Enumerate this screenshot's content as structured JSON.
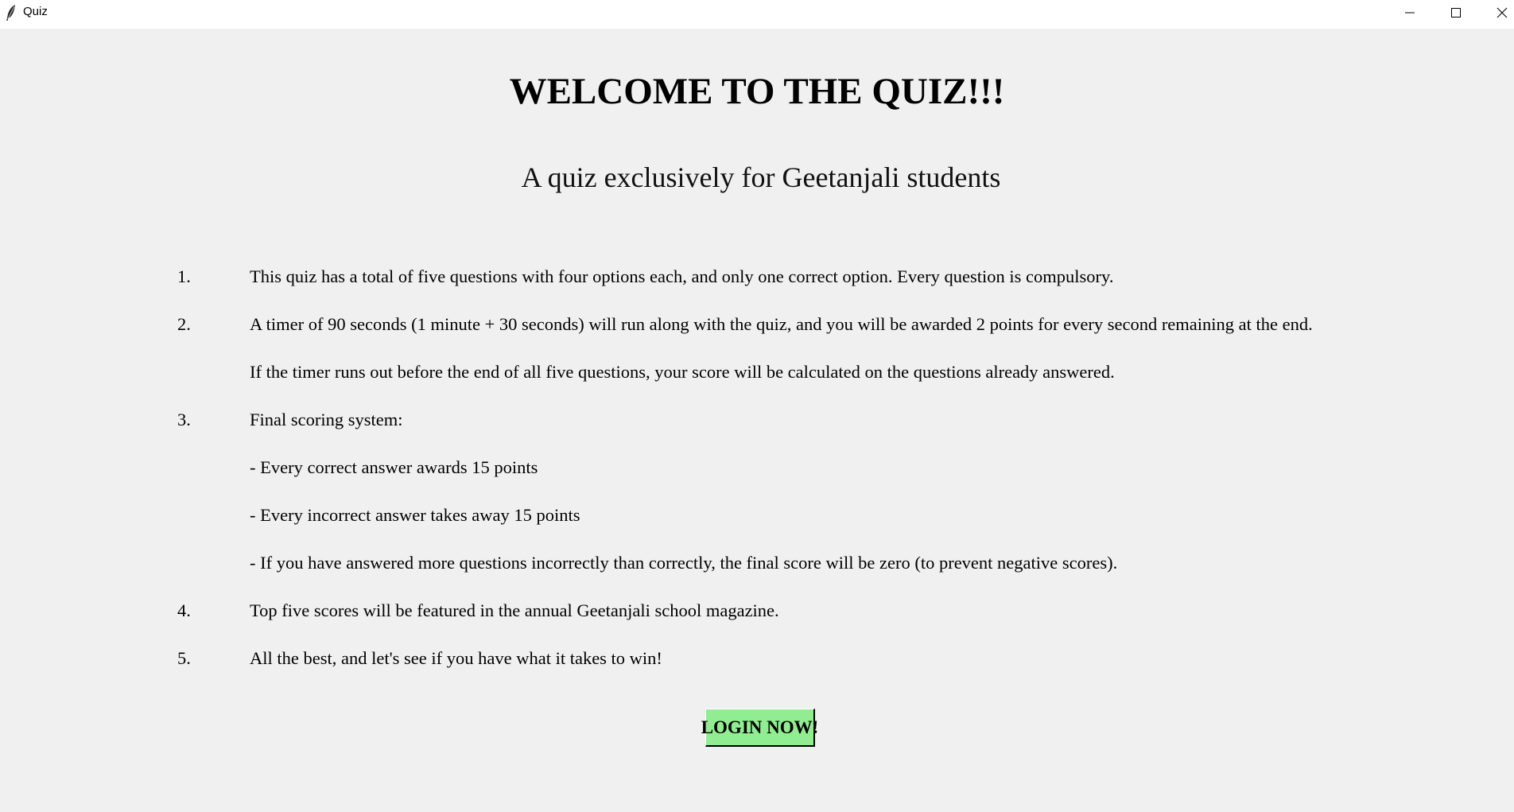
{
  "window": {
    "title": "Quiz",
    "icon": "feather-icon",
    "controls": [
      "minimize-icon",
      "maximize-icon",
      "close-icon"
    ]
  },
  "main": {
    "heading": "WELCOME TO THE QUIZ!!!",
    "subheading": "A quiz exclusively for Geetanjali students",
    "rules": [
      {
        "number": "1.",
        "text": "This quiz has a total of five questions with four options each, and only one correct option. Every question is compulsory."
      },
      {
        "number": "2.",
        "text": "A timer of 90 seconds (1 minute + 30 seconds) will run along with the quiz, and you will be awarded 2 points for every second remaining at the end."
      },
      {
        "number": "",
        "text": "If the timer runs out before the end of all five questions, your score will be calculated on the questions already answered."
      },
      {
        "number": "3.",
        "text": "Final scoring system:"
      },
      {
        "number": "",
        "text": "- Every correct answer awards 15 points"
      },
      {
        "number": "",
        "text": "- Every incorrect answer takes away 15 points"
      },
      {
        "number": "",
        "text": "- If you have answered more questions incorrectly than correctly, the final score will be zero (to prevent negative scores)."
      },
      {
        "number": "4.",
        "text": "Top five scores will be featured in the annual Geetanjali school magazine."
      },
      {
        "number": "5.",
        "text": "All the best, and let's see if you have what it takes to win!"
      }
    ],
    "login_button": "LOGIN NOW!",
    "login_button_color": "#90ee90"
  }
}
